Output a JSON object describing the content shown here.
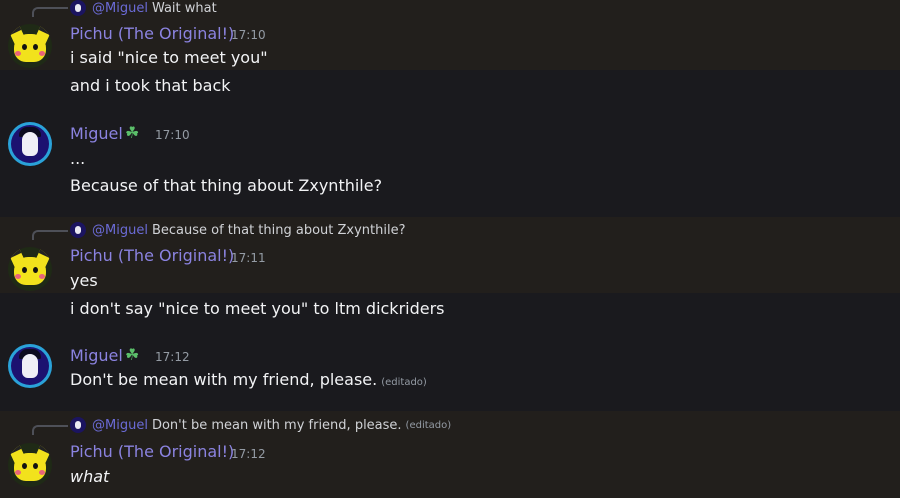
{
  "colors": {
    "background": "#1a1a1e",
    "highlight": "#221f1c",
    "username": "#8b83e0",
    "text": "#f2f3f5",
    "muted": "#949ba4"
  },
  "messages": [
    {
      "reply": {
        "author": "@Miguel",
        "text": "Wait what"
      },
      "author": "Pichu (The Original!)",
      "time": "17:10",
      "lines": [
        "i said \"nice to meet you\"",
        "and i took that back"
      ]
    },
    {
      "author": "Miguel",
      "badge_icon": "clover-icon",
      "time": "17:10",
      "lines": [
        "...",
        "Because of that thing about Zxynthile?"
      ]
    },
    {
      "reply": {
        "author": "@Miguel",
        "text": "Because of that thing about Zxynthile?"
      },
      "author": "Pichu (The Original!)",
      "time": "17:11",
      "lines": [
        "yes",
        "i don't say \"nice to meet you\" to ltm dickriders"
      ]
    },
    {
      "author": "Miguel",
      "badge_icon": "clover-icon",
      "time": "17:12",
      "lines": [
        "Don't be mean with my friend, please."
      ],
      "edited": "(editado)"
    },
    {
      "reply": {
        "author": "@Miguel",
        "text": "Don't be mean with my friend, please.",
        "edited": "(editado)"
      },
      "author": "Pichu (The Original!)",
      "time": "17:12",
      "lines": [
        "what"
      ]
    }
  ]
}
